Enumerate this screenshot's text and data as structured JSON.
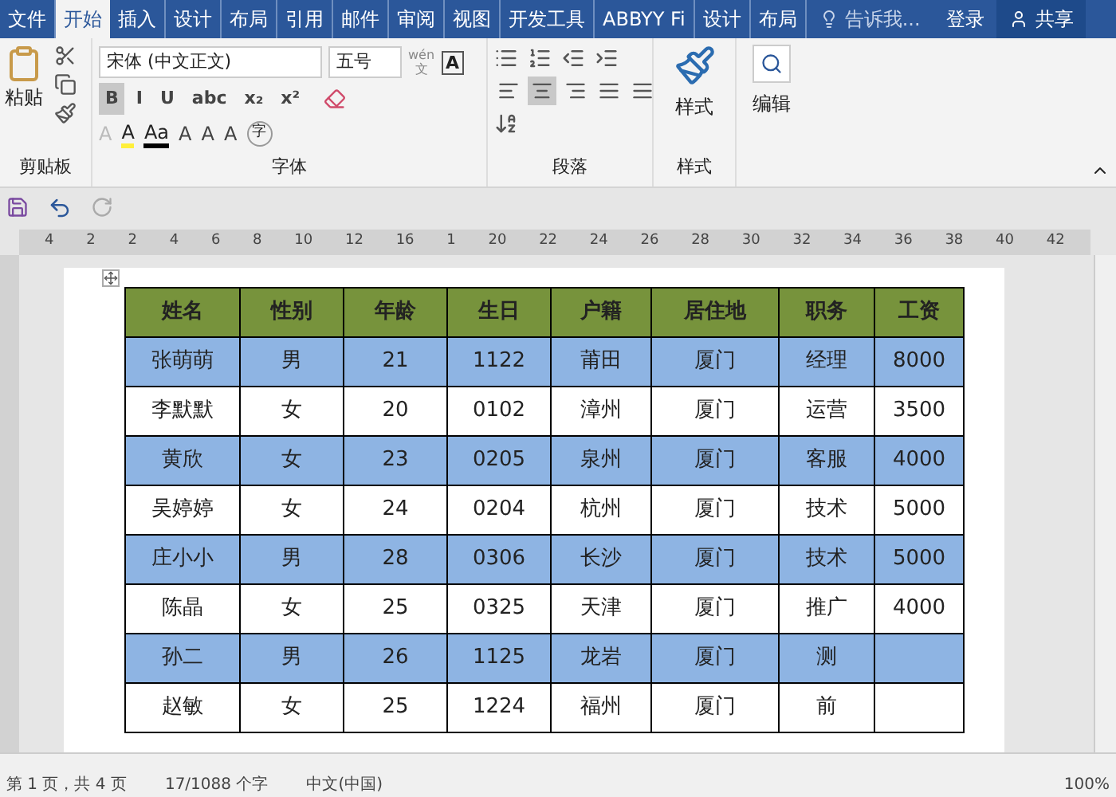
{
  "tabs": [
    {
      "label": "文件",
      "selected": false
    },
    {
      "label": "开始",
      "selected": true
    },
    {
      "label": "插入",
      "selected": false
    },
    {
      "label": "设计",
      "selected": false
    },
    {
      "label": "布局",
      "selected": false
    },
    {
      "label": "引用",
      "selected": false
    },
    {
      "label": "邮件",
      "selected": false
    },
    {
      "label": "审阅",
      "selected": false
    },
    {
      "label": "视图",
      "selected": false
    },
    {
      "label": "开发工具",
      "selected": false
    },
    {
      "label": "ABBYY Fi",
      "selected": false
    },
    {
      "label": "设计",
      "selected": false
    },
    {
      "label": "布局",
      "selected": false
    }
  ],
  "tell_me": "告诉我...",
  "sign_in": "登录",
  "share": "共享",
  "ribbon": {
    "clipboard": {
      "paste": "粘贴",
      "label": "剪贴板"
    },
    "font": {
      "name": "宋体 (中文正文)",
      "size": "五号",
      "label": "字体",
      "phonetic": "wén",
      "phonetic_char": "文",
      "border_char": "A",
      "enclose_char": "字",
      "buttons": [
        {
          "label": "B",
          "selected": true
        },
        {
          "label": "I",
          "selected": false
        },
        {
          "label": "U",
          "selected": false
        },
        {
          "label": "abc",
          "selected": false
        },
        {
          "label": "x₂",
          "selected": false
        },
        {
          "label": "x²",
          "selected": false
        }
      ],
      "row3": [
        "A",
        "A",
        "Aa",
        "A",
        "A",
        "A"
      ]
    },
    "paragraph": {
      "label": "段落",
      "align": [
        {
          "selected": false
        },
        {
          "selected": true
        },
        {
          "selected": false
        },
        {
          "selected": false
        },
        {
          "selected": false
        }
      ]
    },
    "styles": {
      "button": "样式",
      "label": "样式"
    },
    "editing": {
      "button": "编辑"
    }
  },
  "ruler": [
    "4",
    "2",
    "2",
    "4",
    "6",
    "8",
    "10",
    "12",
    "16",
    "1",
    "20",
    "22",
    "24",
    "26",
    "28",
    "30",
    "32",
    "34",
    "36",
    "38",
    "40",
    "42"
  ],
  "table": {
    "columns": [
      "姓名",
      "性别",
      "年龄",
      "生日",
      "户籍",
      "居住地",
      "职务",
      "工资"
    ],
    "rows": [
      {
        "shaded": true,
        "cells": [
          "张萌萌",
          "男",
          "21",
          "1122",
          "莆田",
          "厦门",
          "经理",
          "8000"
        ]
      },
      {
        "shaded": false,
        "cells": [
          "李默默",
          "女",
          "20",
          "0102",
          "漳州",
          "厦门",
          "运营",
          "3500"
        ]
      },
      {
        "shaded": true,
        "cells": [
          "黄欣",
          "女",
          "23",
          "0205",
          "泉州",
          "厦门",
          "客服",
          "4000"
        ]
      },
      {
        "shaded": false,
        "cells": [
          "吴婷婷",
          "女",
          "24",
          "0204",
          "杭州",
          "厦门",
          "技术",
          "5000"
        ]
      },
      {
        "shaded": true,
        "cells": [
          "庄小小",
          "男",
          "28",
          "0306",
          "长沙",
          "厦门",
          "技术",
          "5000"
        ]
      },
      {
        "shaded": false,
        "cells": [
          "陈晶",
          "女",
          "25",
          "0325",
          "天津",
          "厦门",
          "推广",
          "4000"
        ]
      },
      {
        "shaded": true,
        "cells": [
          "孙二",
          "男",
          "26",
          "1125",
          "龙岩",
          "厦门",
          "测"
        ]
      },
      {
        "shaded": false,
        "cells": [
          "赵敏",
          "女",
          "25",
          "1224",
          "福州",
          "厦门",
          "前"
        ]
      }
    ]
  },
  "status_bar": {
    "page": "第 1 页，共 4 页",
    "words": "17/1088 个字",
    "language": "中文(中国)",
    "zoom": "100%"
  }
}
